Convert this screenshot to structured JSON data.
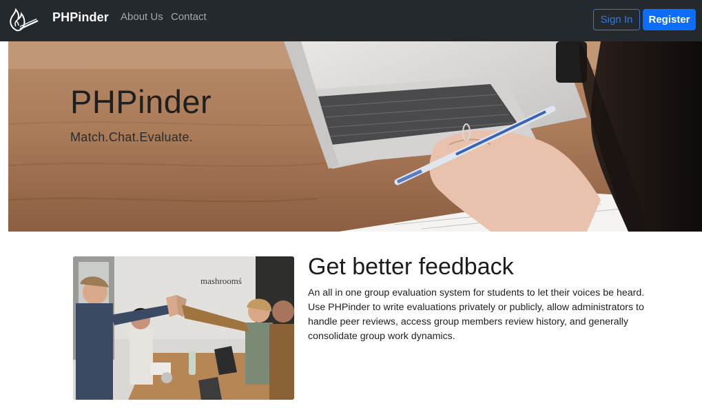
{
  "navbar": {
    "brand": "PHPinder",
    "links": [
      "About Us",
      "Contact"
    ],
    "signin_label": "Sign In",
    "register_label": "Register",
    "logo_icon": "flame-match-icon"
  },
  "hero": {
    "title": "PHPinder",
    "subtitle": "Match.Chat.Evaluate."
  },
  "feature": {
    "title": "Get better feedback",
    "body": "An all in one group evaluation system for students to let their voices be heard. Use PHPinder to write evaluations privately or publicly, allow administrators to handle peer reviews, access group members review history, and generally consolidate group work dynamics.",
    "image_sign": "mashroomś"
  },
  "colors": {
    "navbar_bg": "#24292d",
    "primary": "#0d6efd",
    "nav_link": "#a7aaad"
  }
}
